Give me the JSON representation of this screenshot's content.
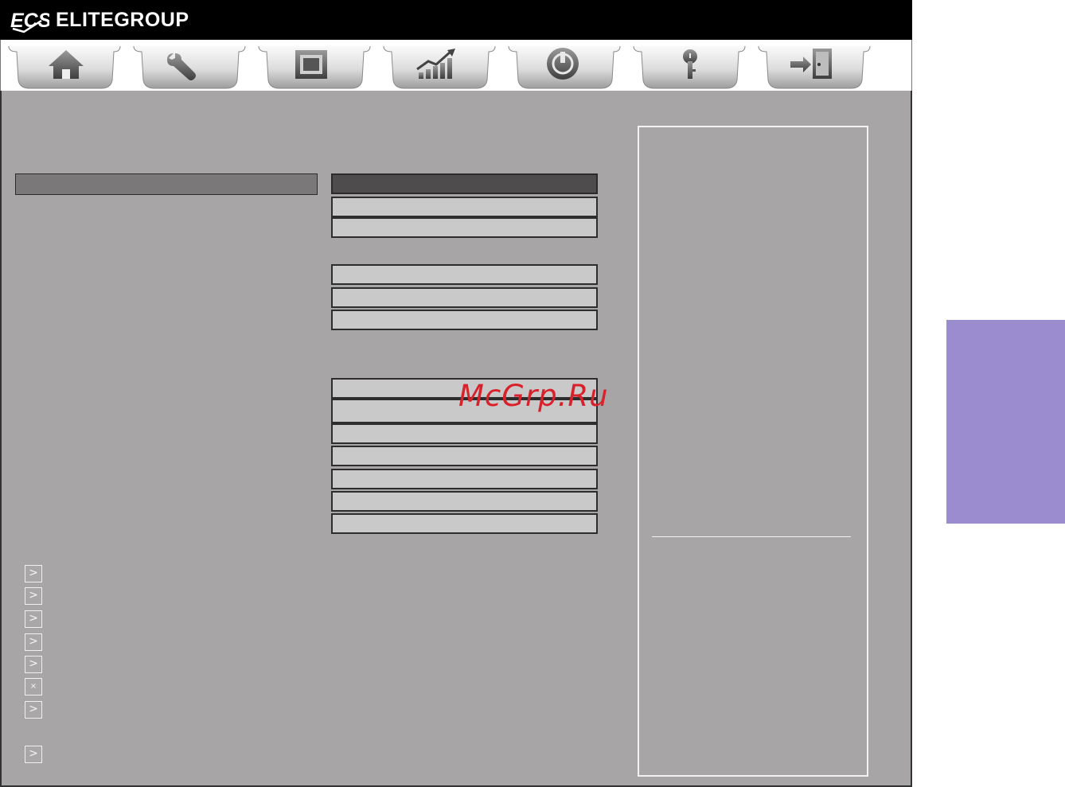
{
  "header": {
    "logo_mark": "ECS",
    "brand": "ELITEGROUP"
  },
  "tabs": [
    {
      "icon": "home-icon"
    },
    {
      "icon": "wrench-icon"
    },
    {
      "icon": "cpu-chip-icon"
    },
    {
      "icon": "bar-chart-icon"
    },
    {
      "icon": "power-icon"
    },
    {
      "icon": "key-icon"
    },
    {
      "icon": "exit-door-icon"
    }
  ],
  "submenu_markers": [
    ">",
    ">",
    ">",
    ">",
    ">",
    "×",
    ">",
    ">"
  ],
  "watermark": "McGrp.Ru",
  "colors": {
    "panel": "#a7a5a6",
    "field": "#c9c9c9",
    "field_selected": "#4e4c4d",
    "side_tab": "#9b8ccf"
  }
}
